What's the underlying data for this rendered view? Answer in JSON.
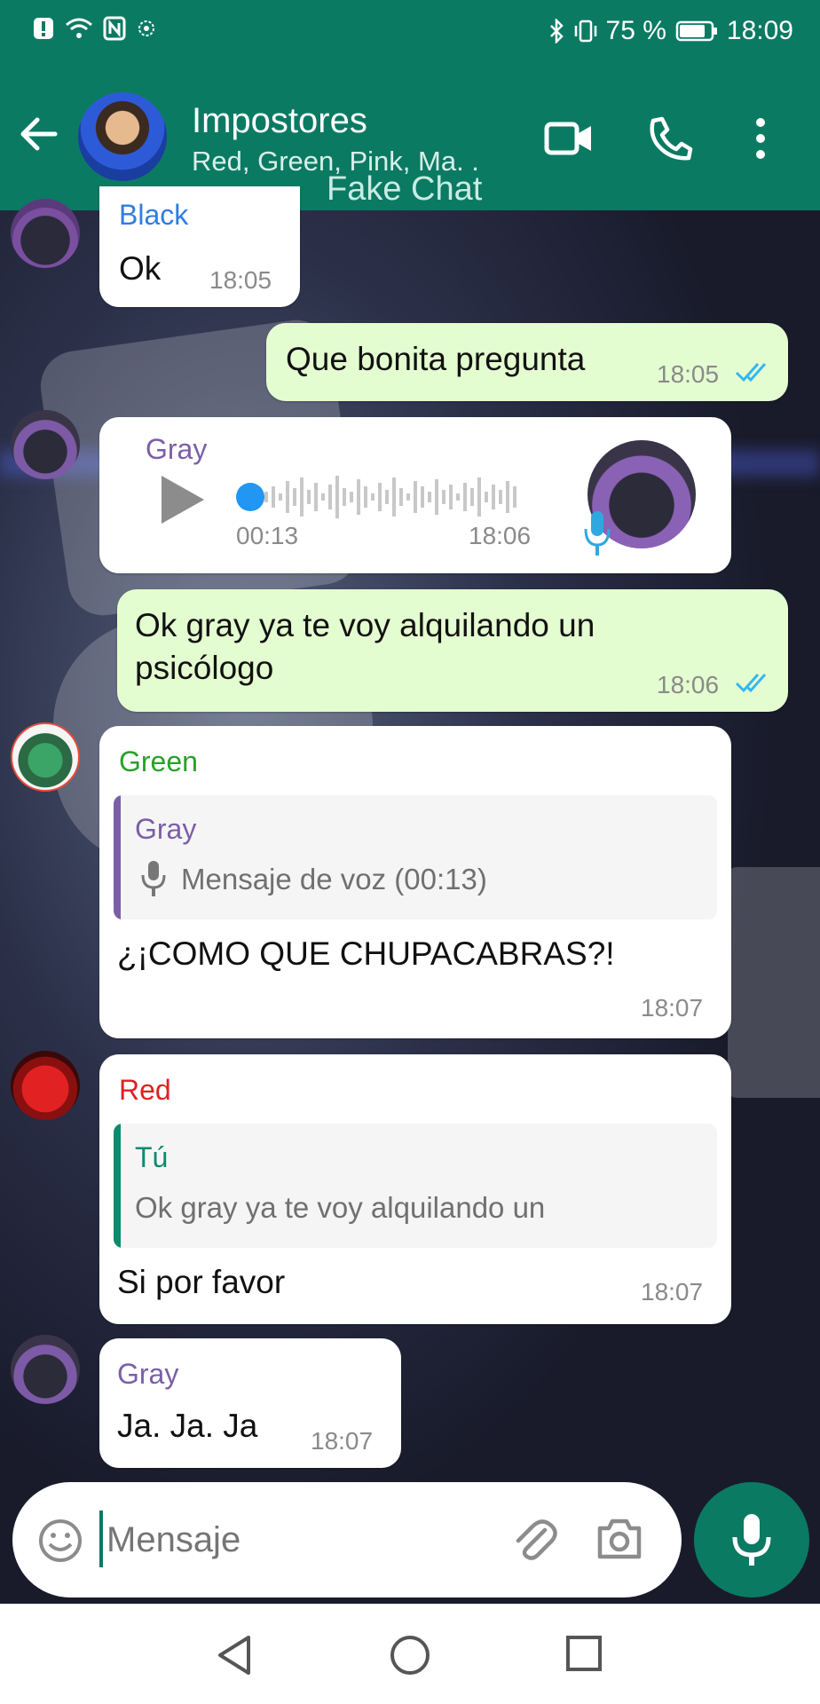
{
  "status_bar": {
    "battery": "75 %",
    "time": "18:09"
  },
  "header": {
    "title": "Impostores",
    "subtitle": "Red, Green, Pink, Ma. .",
    "watermark": "Fake Chat"
  },
  "messages": {
    "m1": {
      "sender": "Black",
      "text": "Ok",
      "time": "18:05"
    },
    "m2": {
      "text": "Que bonita pregunta",
      "time": "18:05"
    },
    "m3": {
      "sender": "Gray",
      "duration": "00:13",
      "time": "18:06"
    },
    "m4": {
      "text_line1": "Ok gray ya te voy alquilando un",
      "text_line2": "psicólogo",
      "time": "18:06"
    },
    "m5": {
      "sender": "Green",
      "quote_sender": "Gray",
      "quote_text": "Mensaje de voz (00:13)",
      "text": "¿¡COMO QUE CHUPACABRAS?!",
      "time": "18:07"
    },
    "m6": {
      "sender": "Red",
      "quote_sender": "Tú",
      "quote_text": "Ok gray ya te voy alquilando un",
      "text": "Si por favor",
      "time": "18:07"
    },
    "m7": {
      "sender": "Gray",
      "text": "Ja. Ja. Ja",
      "time": "18:07"
    }
  },
  "input": {
    "placeholder": "Mensaje"
  },
  "colors": {
    "header": "#0b7a63",
    "black_sender": "#2f7de1",
    "gray_sender": "#7b5ea7",
    "green_sender": "#2aa02a",
    "red_sender": "#e02020",
    "you_quote": "#0b8a6d",
    "read_ticks": "#34b7f1"
  }
}
